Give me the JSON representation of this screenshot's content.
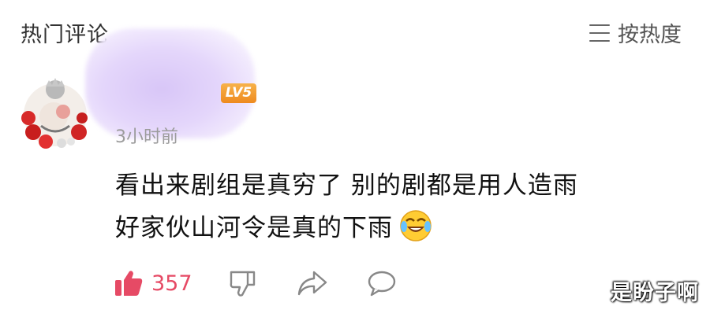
{
  "header": {
    "section_title": "热门评论",
    "sort_label": "按热度"
  },
  "comment": {
    "level_badge": "LV5",
    "timestamp": "3小时前",
    "text_line1": "看出来剧组是真穷了  别的剧都是用人造雨",
    "text_line2": "好家伙山河令是真的下雨",
    "emoji": "laughing-crying-emoji",
    "like_count": "357"
  },
  "watermark": "是盼子啊",
  "icons": [
    "menu-icon",
    "thumbs-up-icon",
    "thumbs-down-icon",
    "share-icon",
    "comment-icon"
  ],
  "colors": {
    "like": "#e64a65",
    "level_badge": "#f09a2c",
    "timestamp": "#9c9c9c",
    "username_blur": "#ddd0f8"
  }
}
